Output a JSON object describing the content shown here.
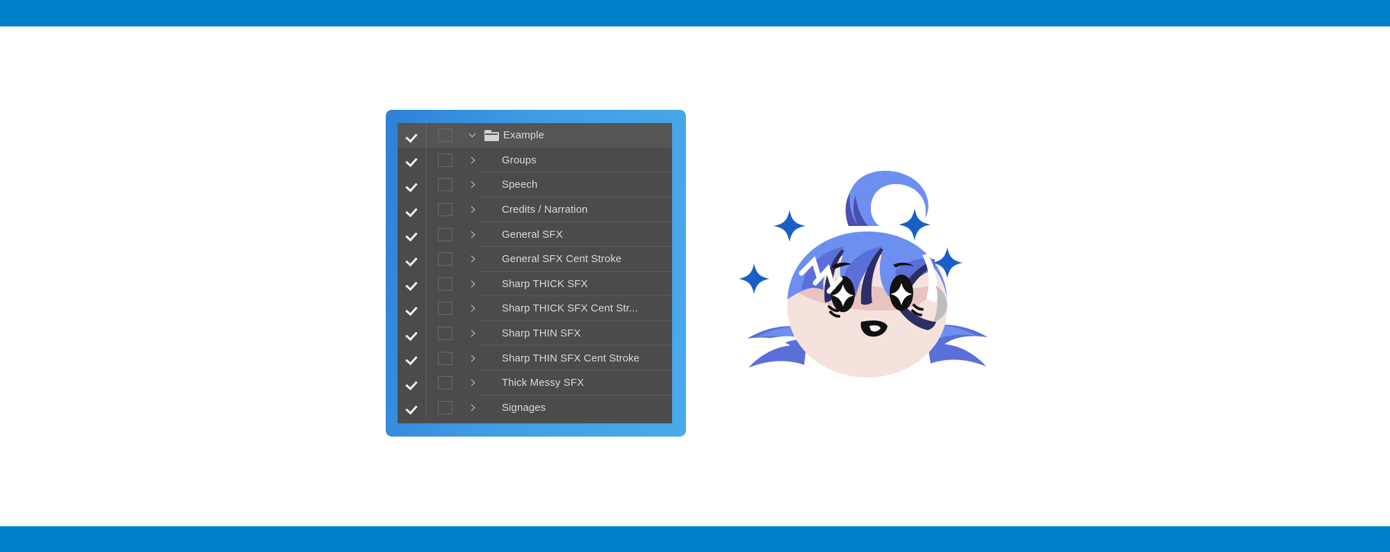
{
  "banners": {
    "color": "#0080c8",
    "top_height": 38,
    "bottom_height": 37
  },
  "panel": {
    "frame_color": "#3f9ce4",
    "background": "#4b4b4b",
    "header_background": "#555555",
    "text_color": "#d9d9d9",
    "check_icon": "check-icon",
    "empty_box_icon": "empty-checkbox-icon",
    "expand_collapsed_icon": "chevron-right-icon",
    "expand_expanded_icon": "chevron-down-icon",
    "folder_icon": "folder-icon",
    "rows": [
      {
        "label": "Example",
        "checked": true,
        "expanded": true,
        "has_folder": true,
        "is_header": true
      },
      {
        "label": "Groups",
        "checked": true,
        "expanded": false,
        "has_folder": false,
        "is_header": false
      },
      {
        "label": "Speech",
        "checked": true,
        "expanded": false,
        "has_folder": false,
        "is_header": false
      },
      {
        "label": "Credits / Narration",
        "checked": true,
        "expanded": false,
        "has_folder": false,
        "is_header": false
      },
      {
        "label": "General SFX",
        "checked": true,
        "expanded": false,
        "has_folder": false,
        "is_header": false
      },
      {
        "label": "General SFX Cent Stroke",
        "checked": true,
        "expanded": false,
        "has_folder": false,
        "is_header": false
      },
      {
        "label": "Sharp THICK SFX",
        "checked": true,
        "expanded": false,
        "has_folder": false,
        "is_header": false
      },
      {
        "label": "Sharp THICK SFX Cent Str...",
        "checked": true,
        "expanded": false,
        "has_folder": false,
        "is_header": false
      },
      {
        "label": "Sharp THIN SFX",
        "checked": true,
        "expanded": false,
        "has_folder": false,
        "is_header": false
      },
      {
        "label": "Sharp THIN SFX Cent Stroke",
        "checked": true,
        "expanded": false,
        "has_folder": false,
        "is_header": false
      },
      {
        "label": "Thick Messy SFX",
        "checked": true,
        "expanded": false,
        "has_folder": false,
        "is_header": false
      },
      {
        "label": "Signages",
        "checked": true,
        "expanded": false,
        "has_folder": false,
        "is_header": false
      }
    ]
  },
  "character": {
    "name": "chibi-anime-head-illustration",
    "hair_light": "#6d8ff0",
    "hair_mid": "#5a6fd8",
    "hair_dark": "#4348a8",
    "hair_outline": "#2b2f66",
    "skin": "#f6e2dc",
    "blush": "#e8c4c0",
    "sparkle_color": "#1a5fc8",
    "gray_streak": "#bdbdbd",
    "eye_color": "#111111",
    "sparkle_count": 4,
    "sweat_line_count": 3
  }
}
